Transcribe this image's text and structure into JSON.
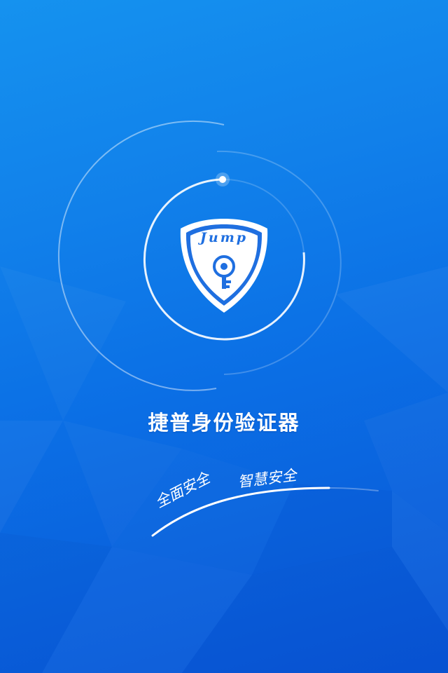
{
  "app": {
    "title": "捷普身份验证器",
    "logo_text": "Jump",
    "logo_icon": "key-icon"
  },
  "slogans": {
    "left": "全面安全",
    "right": "智慧安全"
  },
  "colors": {
    "background_top": "#1592ef",
    "background_bottom": "#0855d6",
    "shield_blue": "#1f6fe0",
    "ring_white": "#ffffff"
  }
}
